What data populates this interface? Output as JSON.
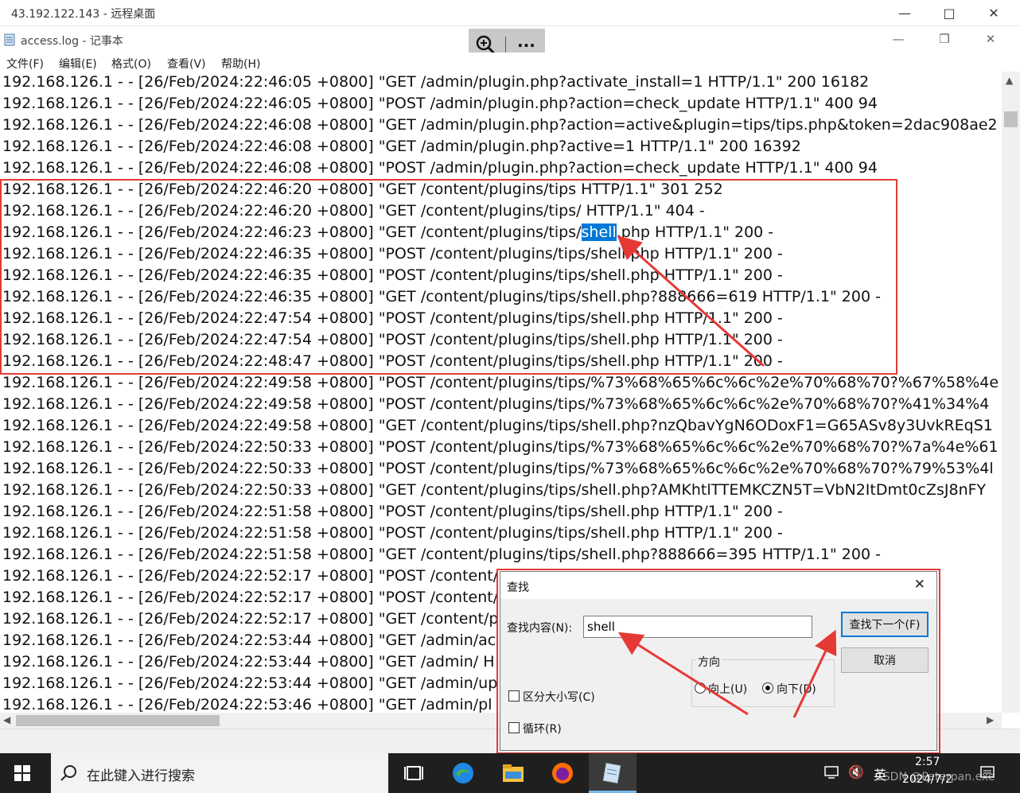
{
  "remote_window": {
    "title": "43.192.122.143 - 远程桌面"
  },
  "notepad": {
    "title": "access.log - 记事本",
    "menu": [
      "文件(F)",
      "编辑(E)",
      "格式(O)",
      "查看(V)",
      "帮助(H)"
    ]
  },
  "rdp_toolbar": {
    "more": "···"
  },
  "log_lines": [
    "192.168.126.1 - - [26/Feb/2024:22:46:05 +0800] \"GET /admin/plugin.php?activate_install=1 HTTP/1.1\" 200 16182",
    "192.168.126.1 - - [26/Feb/2024:22:46:05 +0800] \"POST /admin/plugin.php?action=check_update HTTP/1.1\" 400 94",
    "192.168.126.1 - - [26/Feb/2024:22:46:08 +0800] \"GET /admin/plugin.php?action=active&plugin=tips/tips.php&token=2dac908ae2",
    "192.168.126.1 - - [26/Feb/2024:22:46:08 +0800] \"GET /admin/plugin.php?active=1 HTTP/1.1\" 200 16392",
    "192.168.126.1 - - [26/Feb/2024:22:46:08 +0800] \"POST /admin/plugin.php?action=check_update HTTP/1.1\" 400 94",
    "192.168.126.1 - - [26/Feb/2024:22:46:20 +0800] \"GET /content/plugins/tips HTTP/1.1\" 301 252",
    "192.168.126.1 - - [26/Feb/2024:22:46:20 +0800] \"GET /content/plugins/tips/ HTTP/1.1\" 404 -",
    "192.168.126.1 - - [26/Feb/2024:22:46:23 +0800] \"GET /content/plugins/tips/shell.php HTTP/1.1\" 200 -",
    "192.168.126.1 - - [26/Feb/2024:22:46:35 +0800] \"POST /content/plugins/tips/shell.php HTTP/1.1\" 200 -",
    "192.168.126.1 - - [26/Feb/2024:22:46:35 +0800] \"POST /content/plugins/tips/shell.php HTTP/1.1\" 200 -",
    "192.168.126.1 - - [26/Feb/2024:22:46:35 +0800] \"GET /content/plugins/tips/shell.php?888666=619 HTTP/1.1\" 200 -",
    "192.168.126.1 - - [26/Feb/2024:22:47:54 +0800] \"POST /content/plugins/tips/shell.php HTTP/1.1\" 200 -",
    "192.168.126.1 - - [26/Feb/2024:22:47:54 +0800] \"POST /content/plugins/tips/shell.php HTTP/1.1\" 200 -",
    "192.168.126.1 - - [26/Feb/2024:22:48:47 +0800] \"POST /content/plugins/tips/shell.php HTTP/1.1\" 200 -",
    "192.168.126.1 - - [26/Feb/2024:22:49:58 +0800] \"POST /content/plugins/tips/%73%68%65%6c%6c%2e%70%68%70?%67%58%4e",
    "192.168.126.1 - - [26/Feb/2024:22:49:58 +0800] \"POST /content/plugins/tips/%73%68%65%6c%6c%2e%70%68%70?%41%34%4",
    "192.168.126.1 - - [26/Feb/2024:22:49:58 +0800] \"GET /content/plugins/tips/shell.php?nzQbavYgN6ODoxF1=G65ASv8y3UvkREqS1",
    "192.168.126.1 - - [26/Feb/2024:22:50:33 +0800] \"POST /content/plugins/tips/%73%68%65%6c%6c%2e%70%68%70?%7a%4e%61",
    "192.168.126.1 - - [26/Feb/2024:22:50:33 +0800] \"POST /content/plugins/tips/%73%68%65%6c%6c%2e%70%68%70?%79%53%4l",
    "192.168.126.1 - - [26/Feb/2024:22:50:33 +0800] \"GET /content/plugins/tips/shell.php?AMKhtlTTEMKCZN5T=VbN2ItDmt0cZsJ8nFY",
    "192.168.126.1 - - [26/Feb/2024:22:51:58 +0800] \"POST /content/plugins/tips/shell.php HTTP/1.1\" 200 -",
    "192.168.126.1 - - [26/Feb/2024:22:51:58 +0800] \"POST /content/plugins/tips/shell.php HTTP/1.1\" 200 -",
    "192.168.126.1 - - [26/Feb/2024:22:51:58 +0800] \"GET /content/plugins/tips/shell.php?888666=395 HTTP/1.1\" 200 -",
    "192.168.126.1 - - [26/Feb/2024:22:52:17 +0800] \"POST /content/",
    "192.168.126.1 - - [26/Feb/2024:22:52:17 +0800] \"POST /content/",
    "192.168.126.1 - - [26/Feb/2024:22:52:17 +0800] \"GET /content/p",
    "192.168.126.1 - - [26/Feb/2024:22:53:44 +0800] \"GET /admin/ac",
    "192.168.126.1 - - [26/Feb/2024:22:53:44 +0800] \"GET /admin/ H",
    "192.168.126.1 - - [26/Feb/2024:22:53:44 +0800] \"GET /admin/up",
    "192.168.126.1 - - [26/Feb/2024:22:53:46 +0800] \"GET /admin/pl"
  ],
  "highlight": {
    "line_index": 7,
    "before": "192.168.126.1 - - [26/Feb/2024:22:46:23 +0800] \"GET /content/plugins/tips/",
    "match": "shell",
    "after": ".php HTTP/1.1\" 200 -"
  },
  "find_dialog": {
    "title": "查找",
    "find_label": "查找内容(N):",
    "find_value": "shell",
    "find_next": "查找下一个(F)",
    "cancel": "取消",
    "direction_label": "方向",
    "up": "向上(U)",
    "down": "向下(D)",
    "direction_selected": "down",
    "match_case": "区分大小写(C)",
    "wrap": "循环(R)"
  },
  "taskbar": {
    "search_placeholder": "在此键入进行搜索",
    "ime": "英",
    "time": "2:57",
    "date": "2024/7/2",
    "watermark": "CSDN @Peterpan.exe"
  },
  "colors": {
    "annotation": "#e53935",
    "selection": "#0078d7",
    "taskbar": "#1f1f1f"
  }
}
